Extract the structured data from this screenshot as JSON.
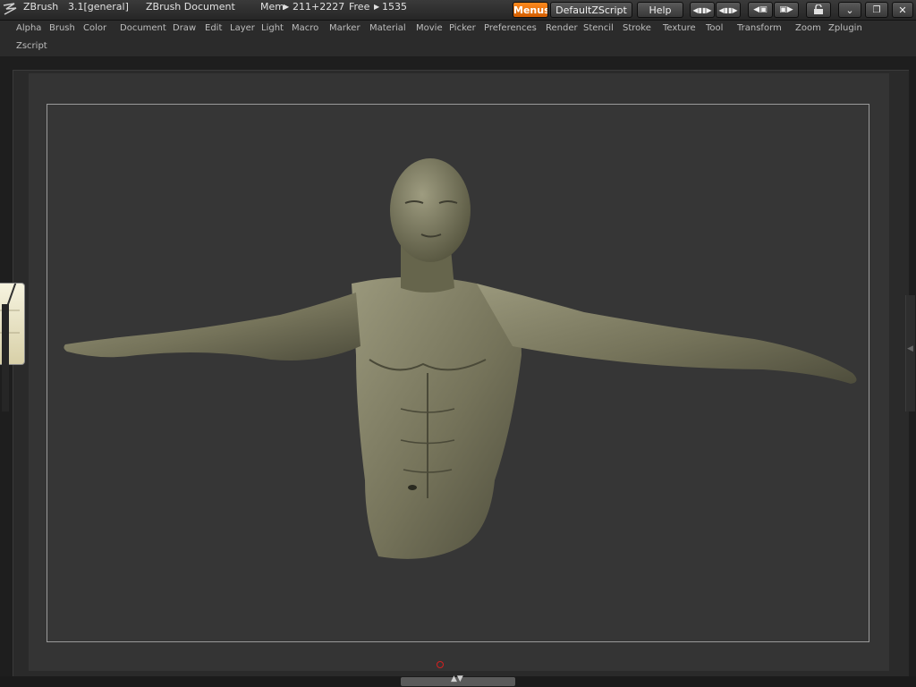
{
  "titlebar": {
    "app_name": "ZBrush",
    "version": "3.1[general]",
    "document": "ZBrush Document",
    "mem_label": "Mem",
    "mem_value": "211+2227",
    "free_label": "Free",
    "free_value": "1535",
    "menus_button": "Menus",
    "script_button": "DefaultZScript",
    "help_button": "Help",
    "icons": [
      "zbrush-logo-icon",
      "shrink-palette-icon",
      "expand-palette-icon",
      "layout-prev-icon",
      "layout-next-icon",
      "lock-icon",
      "minimize-icon",
      "restore-icon",
      "close-icon"
    ]
  },
  "menubar": {
    "items": [
      "Alpha",
      "Brush",
      "Color",
      "Document",
      "Draw",
      "Edit",
      "Layer",
      "Light",
      "Macro",
      "Marker",
      "Material",
      "Movie",
      "Picker",
      "Preferences",
      "Render",
      "Stencil",
      "Stroke",
      "Texture",
      "Tool",
      "Transform",
      "Zoom",
      "Zplugin",
      "Zscript"
    ]
  },
  "colors": {
    "accent": "#f07a10",
    "background": "#1e1e1e",
    "document": "#363636",
    "model_clay": "#7b7a60"
  },
  "canvas": {
    "content": "sculpted male torso with arms outstretched"
  }
}
